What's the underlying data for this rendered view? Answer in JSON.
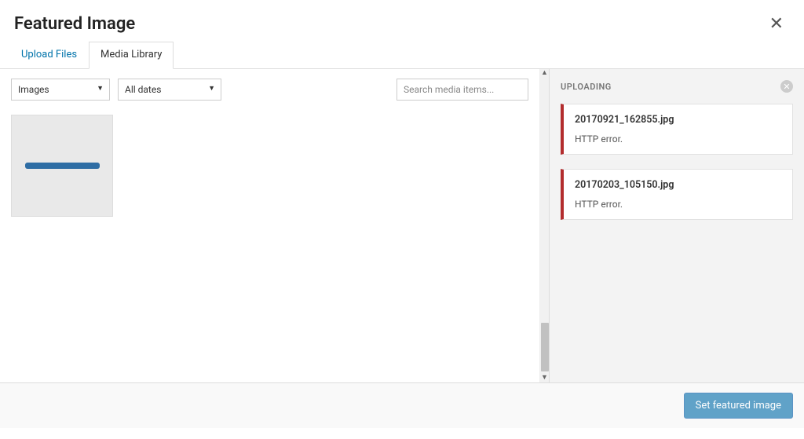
{
  "header": {
    "title": "Featured Image",
    "close_glyph": "✕"
  },
  "tabs": {
    "upload": "Upload Files",
    "library": "Media Library"
  },
  "filters": {
    "type_selected": "Images",
    "date_selected": "All dates"
  },
  "search": {
    "placeholder": "Search media items..."
  },
  "sidebar": {
    "title": "UPLOADING",
    "dismiss_glyph": "✕",
    "uploads": [
      {
        "filename": "20170921_162855.jpg",
        "error": "HTTP error."
      },
      {
        "filename": "20170203_105150.jpg",
        "error": "HTTP error."
      }
    ]
  },
  "footer": {
    "set_label": "Set featured image"
  },
  "scroll": {
    "up": "▲",
    "down": "▼"
  }
}
